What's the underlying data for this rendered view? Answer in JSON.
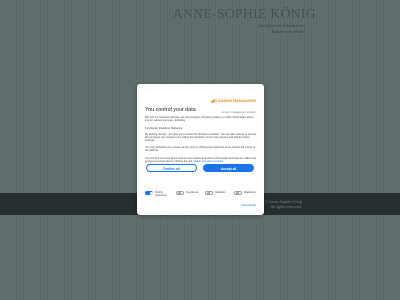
{
  "site": {
    "title": "ANNE-SOPHIE KÖNIG",
    "subtitle_1": "Anwältin für Arbeitsrecht",
    "subtitle_2": "Kanzlei am Markt",
    "copyright_1": "Copyright © Anne-Sophie König",
    "copyright_2": "All rights reserved."
  },
  "consent": {
    "logo_brand": "CONSENTMANAGER",
    "logo_tagline": "consent management solution",
    "heading": "You control your data",
    "text_1": "We and our business partners use technologies, including cookies, to collect information about you for various purposes, including:",
    "text_2": "Functional, Statistical, Marketing",
    "text_3": "By clicking 'Accept', you give your consent for all these purposes. You can also choose to specify the purposes you consent to by ticking the checkbox next to the purpose and clicking 'Save settings'.",
    "text_4": "You may withdraw your consent at any time by clicking the small icon at the bottom left corner of the website.",
    "text_5_prefix": "You can find out more about how we use cookies and other technologies and how we collect and process personal data by clicking the link.",
    "text_5_link": "Read more about cookies",
    "decline_label": "Decline all",
    "accept_label": "Accept all",
    "toggles": [
      {
        "label_1": "Strictly",
        "label_2": "necessary",
        "on": true
      },
      {
        "label_1": "Functional",
        "label_2": "",
        "on": false
      },
      {
        "label_1": "Statistics",
        "label_2": "",
        "on": false
      },
      {
        "label_1": "Marketing",
        "label_2": "",
        "on": false
      }
    ],
    "show_details_label": "Show details"
  },
  "colors": {
    "accent": "#1a73e8",
    "brand": "#e28a1b",
    "page_bg": "#647674",
    "footer_band": "#2a3433"
  }
}
